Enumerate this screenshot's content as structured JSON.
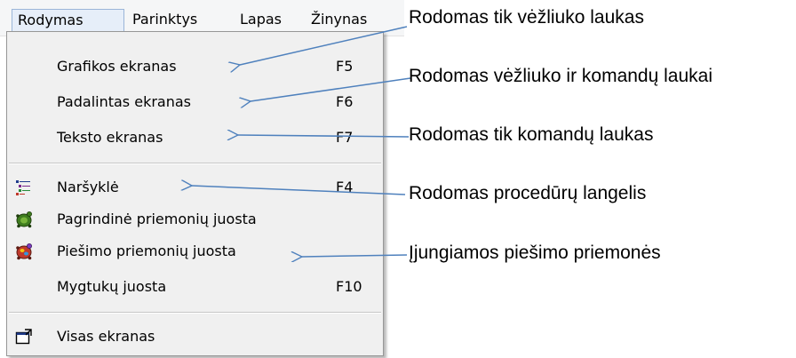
{
  "menubar": {
    "items": [
      {
        "label": "Rodymas",
        "active": true
      },
      {
        "label": "Parinktys"
      },
      {
        "label": "Lapas"
      },
      {
        "label": "Žinynas"
      }
    ]
  },
  "menu": {
    "items": [
      {
        "label": "Grafikos ekranas",
        "shortcut": "F5",
        "icon": ""
      },
      {
        "label": "Padalintas ekranas",
        "shortcut": "F6",
        "icon": ""
      },
      {
        "label": "Teksto ekranas",
        "shortcut": "F7",
        "icon": ""
      },
      {
        "label": "Naršyklė",
        "shortcut": "F4",
        "icon": "browser-tree-icon"
      },
      {
        "label": "Pagrindinė priemonių juosta",
        "shortcut": "",
        "icon": "main-toolbar-turtle-icon"
      },
      {
        "label": "Piešimo priemonių juosta",
        "shortcut": "",
        "icon": "drawing-toolbar-turtle-icon"
      },
      {
        "label": "Mygtukų juosta",
        "shortcut": "F10",
        "icon": ""
      },
      {
        "label": "Visas ekranas",
        "shortcut": "",
        "icon": "fullscreen-window-icon"
      }
    ]
  },
  "annotations": [
    "Rodomas tik vėžliuko laukas",
    "Rodomas vėžliuko ir komandų laukai",
    "Rodomas tik komandų laukas",
    "Rodomas procedūrų langelis",
    "Įjungiamos piešimo priemonės"
  ],
  "colors": {
    "arrow": "#4f81bd",
    "menu_background": "#f0f0f0",
    "active_menubar_background": "#e6eef9"
  }
}
